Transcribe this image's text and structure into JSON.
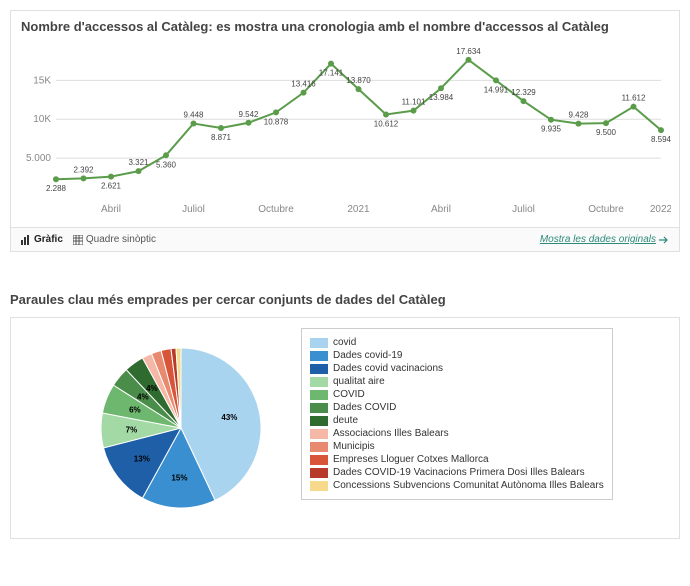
{
  "chart1": {
    "title": "Nombre d'accessos al Catàleg: es mostra una cronologia amb el nombre d'accessos al Catàleg",
    "footer": {
      "tab_chart": "Gràfic",
      "tab_table": "Quadre sinòptic",
      "link": "Mostra les dades originals"
    }
  },
  "chart2": {
    "title": "Paraules clau més emprades per cercar conjunts de dades del Catàleg"
  },
  "chart_data": [
    {
      "type": "line",
      "title": "Nombre d'accessos al Catàleg",
      "x_ticks": [
        "Abril",
        "Juliol",
        "Octubre",
        "2021",
        "Abril",
        "Juliol",
        "Octubre",
        "2022"
      ],
      "y_ticks": [
        5000,
        10000,
        15000
      ],
      "y_tick_labels": [
        "5.000",
        "10K",
        "15K"
      ],
      "ylim": [
        0,
        18000
      ],
      "points": [
        {
          "label": "2.288",
          "value": 2288
        },
        {
          "label": "2.392",
          "value": 2392
        },
        {
          "label": "2.621",
          "value": 2621
        },
        {
          "label": "3.321",
          "value": 3321
        },
        {
          "label": "5.360",
          "value": 5360
        },
        {
          "label": "9.448",
          "value": 9448
        },
        {
          "label": "8.871",
          "value": 8871
        },
        {
          "label": "9.542",
          "value": 9542
        },
        {
          "label": "10.878",
          "value": 10878
        },
        {
          "label": "13.416",
          "value": 13416
        },
        {
          "label": "17.141",
          "value": 17141
        },
        {
          "label": "13.870",
          "value": 13870
        },
        {
          "label": "10.612",
          "value": 10612
        },
        {
          "label": "11.101",
          "value": 11101
        },
        {
          "label": "13.984",
          "value": 13984
        },
        {
          "label": "17.634",
          "value": 17634
        },
        {
          "label": "14.991",
          "value": 14991
        },
        {
          "label": "12.329",
          "value": 12329
        },
        {
          "label": "9.935",
          "value": 9935
        },
        {
          "label": "9.428",
          "value": 9428
        },
        {
          "label": "9.500",
          "value": 9500
        },
        {
          "label": "11.612",
          "value": 11612
        },
        {
          "label": "8.594",
          "value": 8594
        }
      ]
    },
    {
      "type": "pie",
      "title": "Paraules clau més emprades",
      "slices": [
        {
          "label": "covid",
          "pct": 43,
          "color": "#a9d4f0",
          "show_pct": true
        },
        {
          "label": "Dades covid-19",
          "pct": 15,
          "color": "#3a8fd0",
          "show_pct": true
        },
        {
          "label": "Dades covid vacinacions",
          "pct": 13,
          "color": "#1f5fa8",
          "show_pct": true
        },
        {
          "label": "qualitat aire",
          "pct": 7,
          "color": "#a3d9a5",
          "show_pct": true
        },
        {
          "label": "COVID",
          "pct": 6,
          "color": "#6db76f",
          "show_pct": true
        },
        {
          "label": "Dades COVID",
          "pct": 4,
          "color": "#4a8c4a",
          "show_pct": true
        },
        {
          "label": "deute",
          "pct": 4,
          "color": "#2f6b2f",
          "show_pct": true
        },
        {
          "label": "Associacions Illes Balears",
          "pct": 2,
          "color": "#f5b7a6",
          "show_pct": false
        },
        {
          "label": "Municipis",
          "pct": 2,
          "color": "#e88a6f",
          "show_pct": false
        },
        {
          "label": "Empreses Lloguer Cotxes Mallorca",
          "pct": 2,
          "color": "#d9553a",
          "show_pct": false
        },
        {
          "label": "Dades COVID-19 Vacinacions Primera Dosi Illes Balears",
          "pct": 1,
          "color": "#b83a2a",
          "show_pct": false
        },
        {
          "label": "Concessions Subvencions Comunitat Autònoma Illes Balears",
          "pct": 1,
          "color": "#f7d98c",
          "show_pct": false
        }
      ]
    }
  ]
}
